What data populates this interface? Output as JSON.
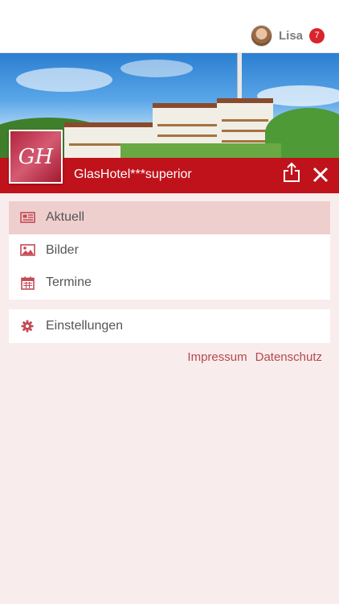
{
  "user": {
    "name": "Lisa",
    "notification_count": "7"
  },
  "hotel": {
    "title": "GlasHotel***superior",
    "logo_letters": "GH"
  },
  "menu": [
    {
      "label": "Aktuell",
      "icon": "newspaper-icon",
      "active": true
    },
    {
      "label": "Bilder",
      "icon": "image-icon",
      "active": false
    },
    {
      "label": "Termine",
      "icon": "calendar-icon",
      "active": false
    }
  ],
  "settings": {
    "label": "Einstellungen",
    "icon": "gear-icon"
  },
  "footer_links": {
    "impressum": "Impressum",
    "datenschutz": "Datenschutz"
  },
  "colors": {
    "brand_red": "#c0121b",
    "accent_pink": "#efcece",
    "background": "#f9ecec",
    "icon_red": "#c44a55",
    "link": "#b5494f"
  }
}
